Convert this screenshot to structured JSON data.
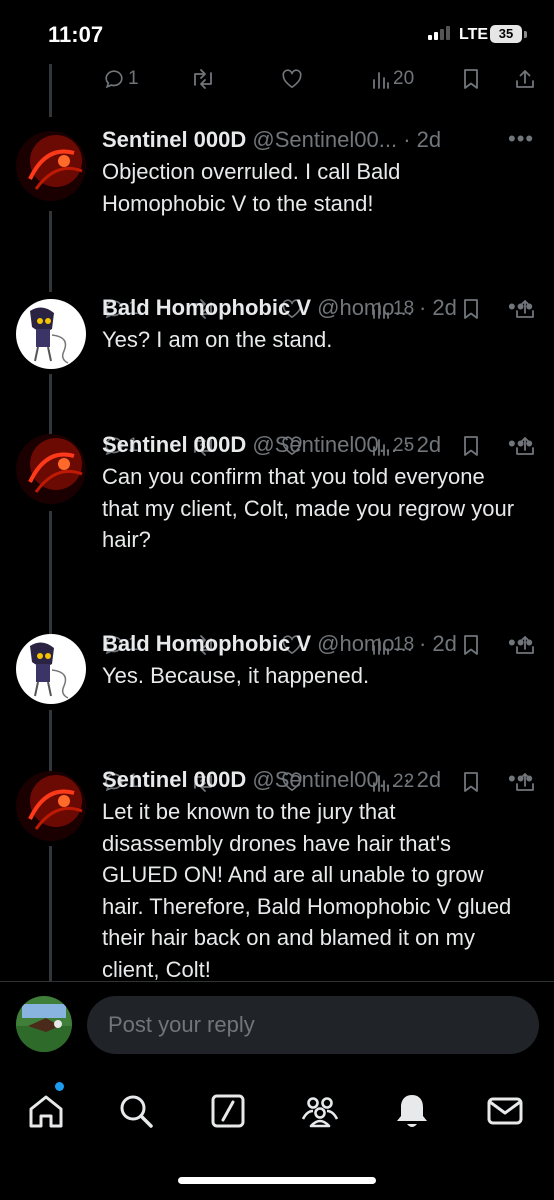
{
  "status_bar": {
    "time": "11:07",
    "network": "LTE",
    "battery": "35"
  },
  "top_actions": {
    "replies": "1",
    "retweets": "",
    "likes": "",
    "views": "20"
  },
  "tweets": [
    {
      "name": "Sentinel 000D",
      "handle": "@Sentinel00...",
      "separator": "·",
      "age": "2d",
      "text": "Objection overruled. I call Bald Homophobic V to the stand!",
      "replies": "1",
      "views": "18"
    },
    {
      "name": "Bald Homophobic V",
      "handle": "@homo...",
      "separator": "·",
      "age": "2d",
      "text": "Yes? I am on the stand.",
      "replies": "1",
      "views": "25"
    },
    {
      "name": "Sentinel 000D",
      "handle": "@Sentinel00...",
      "separator": "·",
      "age": "2d",
      "text": "Can you confirm that you told everyone that my client, Colt, made you regrow your hair?",
      "replies": "1",
      "views": "18"
    },
    {
      "name": "Bald Homophobic V",
      "handle": "@homo...",
      "separator": "·",
      "age": "2d",
      "text": "Yes. Because, it happened.",
      "replies": "1",
      "views": "22"
    },
    {
      "name": "Sentinel 000D",
      "handle": "@Sentinel00...",
      "separator": "·",
      "age": "2d",
      "text": "Let it be known to the jury that disassembly drones have hair that's GLUED ON! And are all unable to grow hair. Therefore, Bald Homophobic V glued their hair back on and blamed it on my client, Colt!"
    }
  ],
  "compose": {
    "placeholder": "Post your reply"
  },
  "tabbar": {
    "icons": [
      "home-icon",
      "search-icon",
      "grok-icon",
      "communities-icon",
      "notifications-icon",
      "messages-icon"
    ]
  },
  "colors": {
    "background": "#000000",
    "text": "#e7e9ea",
    "muted": "#71767b",
    "accent": "#1d9bf0",
    "input": "#202327"
  }
}
